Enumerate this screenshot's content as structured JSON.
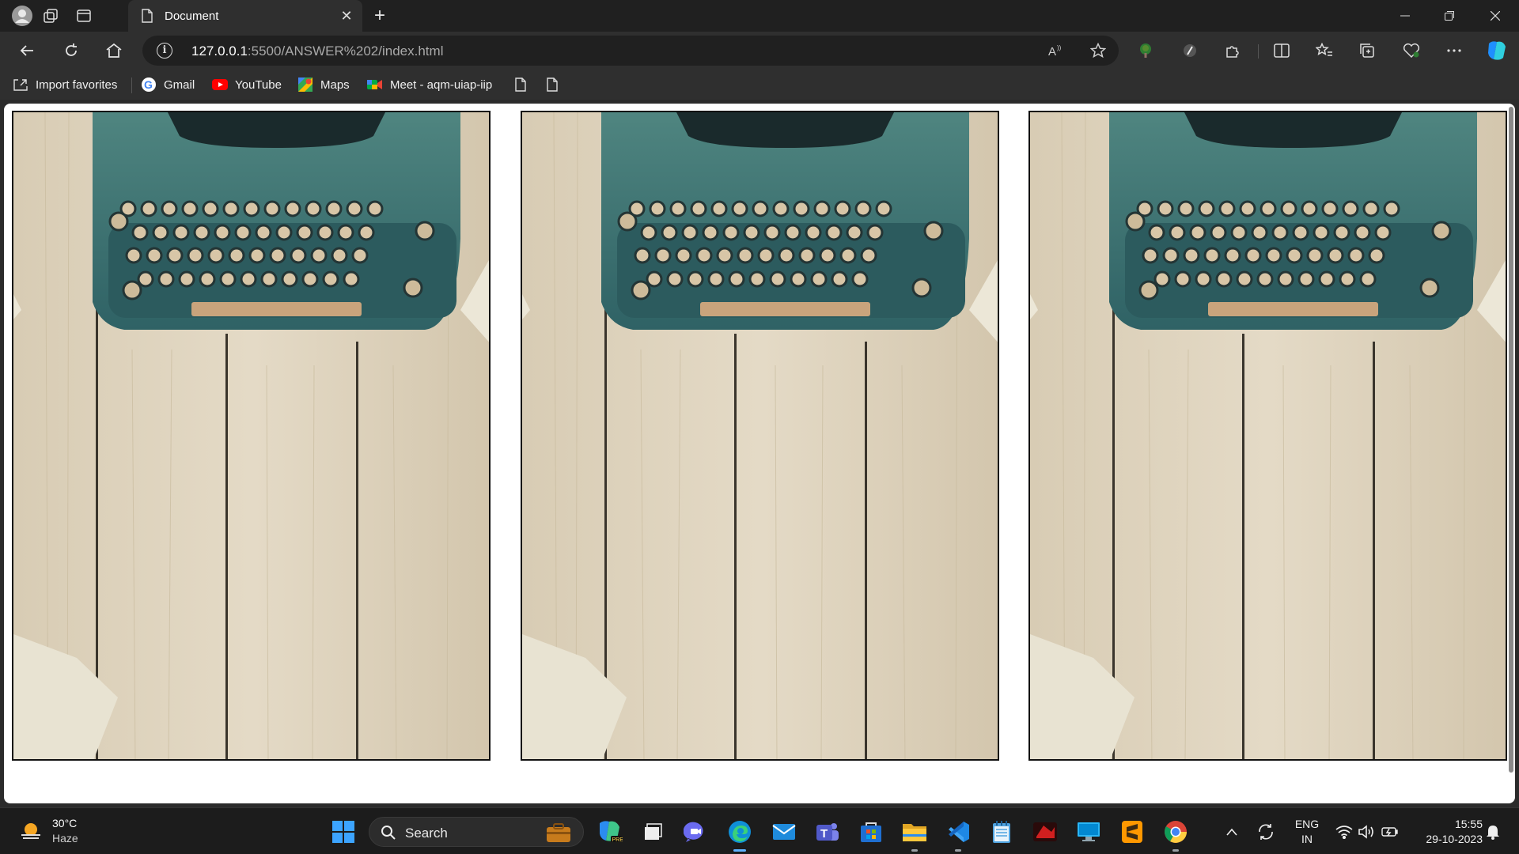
{
  "browser": {
    "tab_title": "Document",
    "url_host": "127.0.0.1",
    "url_path": ":5500/ANSWER%202/index.html",
    "new_tab": "+",
    "close_tab": "✕"
  },
  "favorites": [
    {
      "label": "Import favorites",
      "icon": "import-icon"
    },
    {
      "label": "Gmail",
      "icon": "google-icon"
    },
    {
      "label": "YouTube",
      "icon": "youtube-icon"
    },
    {
      "label": "Maps",
      "icon": "maps-icon"
    },
    {
      "label": "Meet - aqm-uiap-iip",
      "icon": "meet-icon"
    }
  ],
  "page": {
    "images": [
      {
        "alt": "typewriter on wooden desk"
      },
      {
        "alt": "typewriter on wooden desk"
      },
      {
        "alt": "typewriter on wooden desk"
      }
    ]
  },
  "taskbar": {
    "temperature": "30°C",
    "condition": "Haze",
    "search_label": "Search",
    "language": "ENG",
    "region": "IN",
    "time": "15:55",
    "date": "29-10-2023"
  },
  "colors": {
    "titlebar": "#202020",
    "toolbar": "#2f2f2f",
    "typewriter": "#3d6f6f",
    "wood": "#d9cdb7"
  }
}
